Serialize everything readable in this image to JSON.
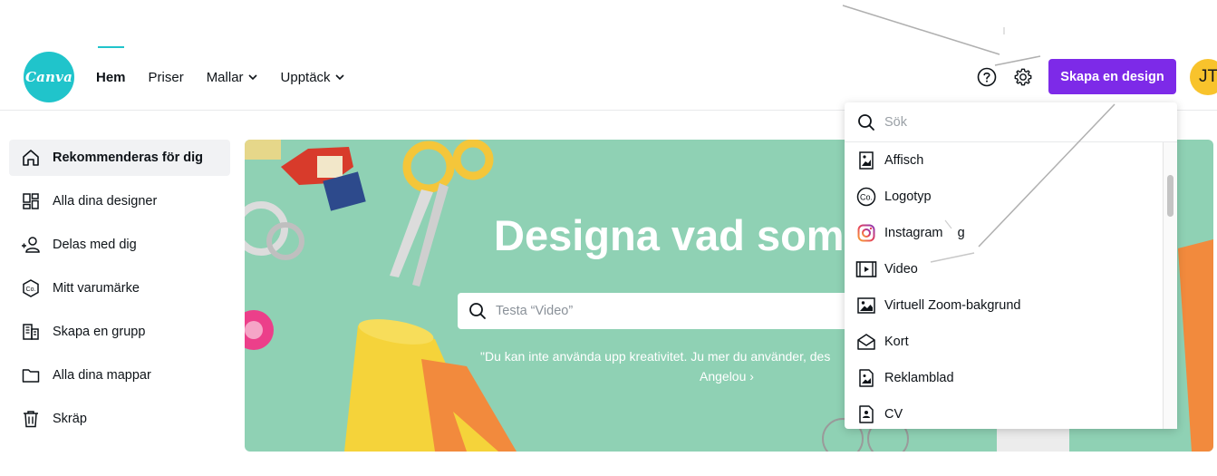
{
  "logo": {
    "text": "Canva"
  },
  "nav": {
    "items": [
      {
        "label": "Hem",
        "active": true,
        "dropdown": false
      },
      {
        "label": "Priser",
        "active": false,
        "dropdown": false
      },
      {
        "label": "Mallar",
        "active": false,
        "dropdown": true
      },
      {
        "label": "Upptäck",
        "active": false,
        "dropdown": true
      }
    ]
  },
  "header": {
    "help_icon": "question-circle-icon",
    "settings_icon": "gear-icon",
    "create_label": "Skapa en design",
    "avatar_initials": "JT",
    "accent_color": "#7d2ae8"
  },
  "sidebar": {
    "items": [
      {
        "label": "Rekommenderas för dig",
        "icon": "home-icon",
        "active": true
      },
      {
        "label": "Alla dina designer",
        "icon": "grid-icon",
        "active": false
      },
      {
        "label": "Delas med dig",
        "icon": "people-add-icon",
        "active": false
      },
      {
        "label": "Mitt varumärke",
        "icon": "brand-badge-icon",
        "active": false
      },
      {
        "label": "Skapa en grupp",
        "icon": "building-icon",
        "active": false
      },
      {
        "label": "Alla dina mappar",
        "icon": "folder-icon",
        "active": false
      },
      {
        "label": "Skräp",
        "icon": "trash-icon",
        "active": false
      }
    ]
  },
  "hero": {
    "title": "Designa vad som",
    "search_placeholder": "Testa “Video”",
    "quote_line1": "\"Du kan inte använda upp kreativitet. Ju mer du använder, des",
    "quote_line2": "Angelou ›",
    "background_color": "#8fd1b4"
  },
  "dropdown": {
    "search_placeholder": "Sök",
    "items": [
      {
        "label": "Affisch",
        "icon": "poster-icon"
      },
      {
        "label": "Logotyp",
        "icon": "logo-co-icon"
      },
      {
        "label": "Instagram    g",
        "icon": "instagram-icon"
      },
      {
        "label": "Video",
        "icon": "video-icon"
      },
      {
        "label": "Virtuell Zoom-bakgrund",
        "icon": "image-icon"
      },
      {
        "label": "Kort",
        "icon": "card-envelope-icon"
      },
      {
        "label": "Reklamblad",
        "icon": "flyer-icon"
      },
      {
        "label": "CV",
        "icon": "resume-icon"
      }
    ]
  }
}
